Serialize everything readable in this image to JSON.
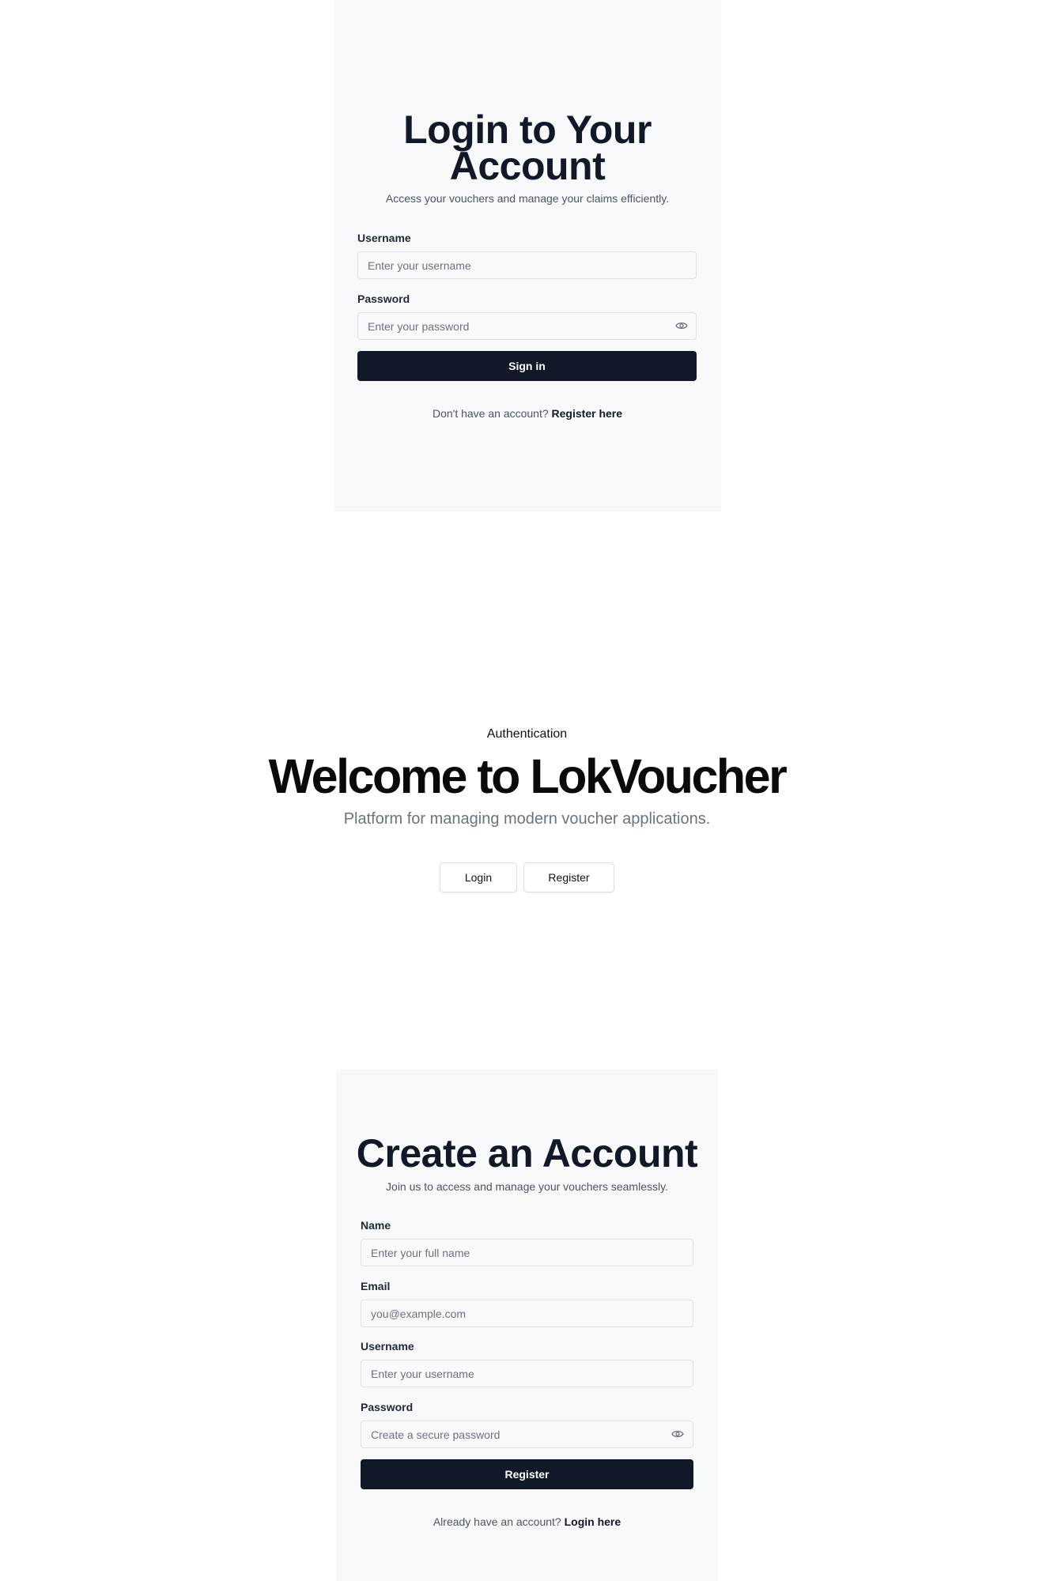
{
  "login": {
    "title": "Login to Your Account",
    "subtitle": "Access your vouchers and manage your claims efficiently.",
    "username_label": "Username",
    "username_placeholder": "Enter your username",
    "password_label": "Password",
    "password_placeholder": "Enter your password",
    "submit_label": "Sign in",
    "footer_text": "Don't have an account?",
    "footer_link": "Register here"
  },
  "hero": {
    "eyebrow": "Authentication",
    "title": "Welcome to LokVoucher",
    "subtitle": "Platform for managing modern voucher applications.",
    "login_button": "Login",
    "register_button": "Register"
  },
  "register": {
    "title": "Create an Account",
    "subtitle": "Join us to access and manage your vouchers seamlessly.",
    "name_label": "Name",
    "name_placeholder": "Enter your full name",
    "email_label": "Email",
    "email_placeholder": "you@example.com",
    "username_label": "Username",
    "username_placeholder": "Enter your username",
    "password_label": "Password",
    "password_placeholder": "Create a secure password",
    "submit_label": "Register",
    "footer_text": "Already have an account?",
    "footer_link": "Login here"
  },
  "icons": {
    "password_toggle": "eye-icon"
  },
  "colors": {
    "primary": "#111827",
    "card_background": "#f8f9fb",
    "muted_text": "#6b7280"
  }
}
